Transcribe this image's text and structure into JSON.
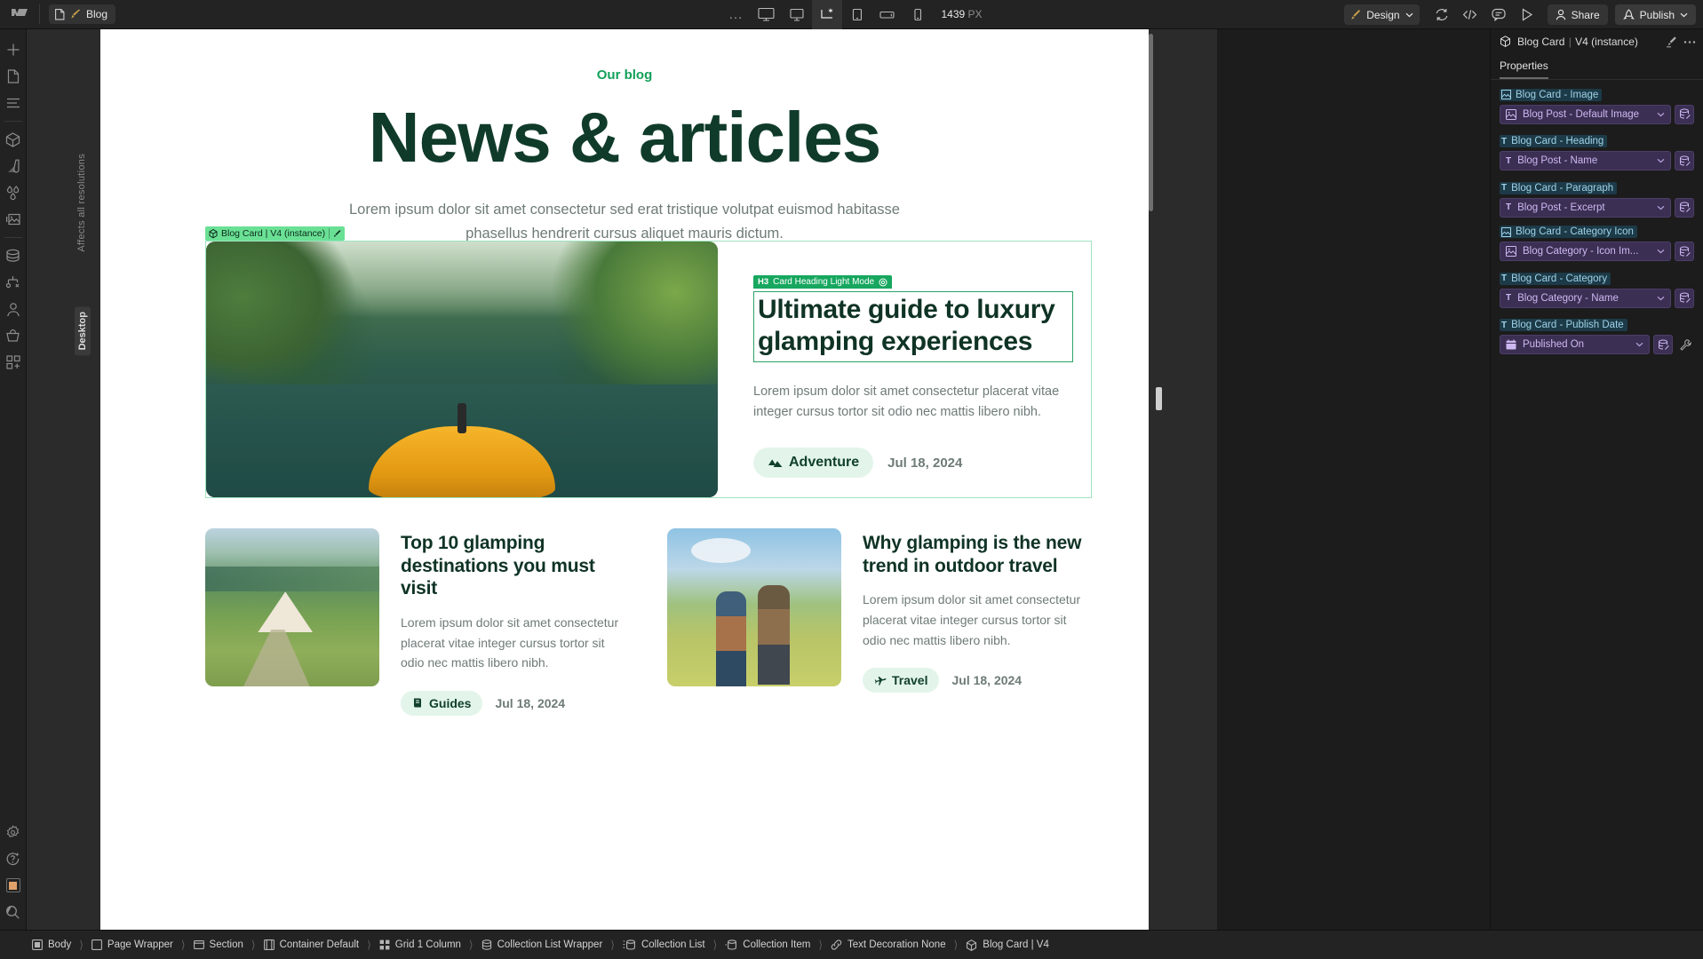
{
  "topbar": {
    "logo": "webflow-logo",
    "page_tab": {
      "label": "Blog",
      "page_icon": "page-icon",
      "brush_icon": "brush-icon"
    },
    "more_dots": "...",
    "breakpoints": [
      {
        "name": "desktop-large",
        "icon": "monitor-large-icon",
        "active": false
      },
      {
        "name": "desktop",
        "icon": "monitor-icon",
        "active": false
      },
      {
        "name": "laptop-base",
        "icon": "laptop-base-icon",
        "active": true
      },
      {
        "name": "tablet",
        "icon": "tablet-icon",
        "active": false
      },
      {
        "name": "mobile-landscape",
        "icon": "mobile-landscape-icon",
        "active": false
      },
      {
        "name": "mobile-portrait",
        "icon": "mobile-portrait-icon",
        "active": false
      }
    ],
    "viewport_value": "1439",
    "viewport_unit": "PX",
    "design_mode": "Design",
    "actions": [
      {
        "name": "sync-icon"
      },
      {
        "name": "code-icon"
      },
      {
        "name": "comment-icon"
      },
      {
        "name": "preview-icon"
      }
    ],
    "share_label": "Share",
    "publish_label": "Publish"
  },
  "left_rail": {
    "items": [
      {
        "name": "add-element",
        "icon": "plus-icon"
      },
      {
        "name": "pages",
        "icon": "page-icon"
      },
      {
        "name": "navigator",
        "icon": "layers-icon"
      },
      {
        "name": "components",
        "icon": "cube-icon"
      },
      {
        "name": "style-selectors",
        "icon": "paint-swatch-icon"
      },
      {
        "name": "variables",
        "icon": "droplets-icon"
      },
      {
        "name": "assets",
        "icon": "image-icon"
      },
      {
        "name": "cms",
        "icon": "database-icon"
      },
      {
        "name": "logic",
        "icon": "logic-icon"
      },
      {
        "name": "users",
        "icon": "user-icon"
      },
      {
        "name": "ecommerce",
        "icon": "basket-icon"
      },
      {
        "name": "apps",
        "icon": "apps-grid-icon"
      }
    ],
    "bottom_items": [
      {
        "name": "settings",
        "icon": "gear-icon"
      },
      {
        "name": "ai-help",
        "icon": "help-sparkle-icon"
      },
      {
        "name": "color-swatch",
        "icon": "orange-square-icon"
      },
      {
        "name": "search",
        "icon": "magnifier-icon"
      },
      {
        "name": "video",
        "icon": "video-camera-icon"
      }
    ]
  },
  "canvas": {
    "ruler_note": "Affects all resolutions",
    "breakpoint_chip": "Desktop",
    "component_badge": {
      "label": "Blog Card | V4 (instance)",
      "cube_icon": "cube-icon",
      "edit_icon": "pencil-icon"
    },
    "page": {
      "eyebrow": "Our blog",
      "title": "News & articles",
      "subtitle": "Lorem ipsum dolor sit amet consectetur sed erat tristique volutpat euismod habitasse phasellus hendrerit cursus aliquet mauris dictum."
    },
    "hero_card": {
      "image_alt": "kayak-on-forest-lake-image",
      "heading_badge": {
        "tag": "H3",
        "label": "Card Heading Light Mode",
        "state_icon": "target-icon"
      },
      "heading": "Ultimate guide to luxury glamping experiences",
      "paragraph": "Lorem ipsum dolor sit amet consectetur placerat vitae integer cursus tortor sit odio nec mattis libero nibh.",
      "category": "Adventure",
      "category_icon": "mountain-icon",
      "date": "Jul 18, 2024"
    },
    "cards": [
      {
        "image_alt": "glamping-tent-in-valley-image",
        "heading": "Top 10 glamping destinations you must visit",
        "paragraph": "Lorem ipsum dolor sit amet consectetur placerat vitae integer cursus tortor sit odio nec mattis libero nibh.",
        "category": "Guides",
        "category_icon": "book-icon",
        "date": "Jul 18, 2024"
      },
      {
        "image_alt": "couple-with-backpacks-image",
        "heading": "Why glamping is the new trend in outdoor travel",
        "paragraph": "Lorem ipsum dolor sit amet consectetur placerat vitae integer cursus tortor sit odio nec mattis libero nibh.",
        "category": "Travel",
        "category_icon": "airplane-icon",
        "date": "Jul 18, 2024"
      }
    ]
  },
  "right_panel": {
    "header": {
      "component": "Blog Card",
      "variant": "V4 (instance)",
      "cube_icon": "cube-icon",
      "edit_icon": "edit-component-icon",
      "more_icon": "more-dots-icon"
    },
    "tab": "Properties",
    "properties": [
      {
        "label": "Blog Card - Image",
        "label_icon": "image-icon",
        "value": "Blog Post - Default Image",
        "value_icon": "image-icon",
        "has_db": true,
        "has_wrench": false
      },
      {
        "label": "Blog Card - Heading",
        "label_icon": "text-icon",
        "value": "Blog Post - Name",
        "value_icon": "text-icon",
        "has_db": true,
        "has_wrench": false
      },
      {
        "label": "Blog Card - Paragraph",
        "label_icon": "text-icon",
        "value": "Blog Post - Excerpt",
        "value_icon": "text-icon",
        "has_db": true,
        "has_wrench": false
      },
      {
        "label": "Blog Card - Category Icon",
        "label_icon": "image-icon",
        "value": "Blog Category - Icon Im...",
        "value_icon": "image-icon",
        "has_db": true,
        "has_wrench": false
      },
      {
        "label": "Blog Card - Category",
        "label_icon": "text-icon",
        "value": "Blog Category - Name",
        "value_icon": "text-icon",
        "has_db": true,
        "has_wrench": false
      },
      {
        "label": "Blog Card - Publish Date",
        "label_icon": "text-icon",
        "value": "Published On",
        "value_icon": "calendar-icon",
        "has_db": true,
        "has_wrench": true
      }
    ]
  },
  "breadcrumbs": [
    {
      "label": "Body",
      "icon": "body-icon"
    },
    {
      "label": "Page Wrapper",
      "icon": "div-icon"
    },
    {
      "label": "Section",
      "icon": "section-icon"
    },
    {
      "label": "Container Default",
      "icon": "container-icon"
    },
    {
      "label": "Grid 1 Column",
      "icon": "grid-icon"
    },
    {
      "label": "Collection List Wrapper",
      "icon": "collection-icon"
    },
    {
      "label": "Collection List",
      "icon": "collection-list-icon"
    },
    {
      "label": "Collection Item",
      "icon": "collection-item-icon"
    },
    {
      "label": "Text Decoration None",
      "icon": "link-icon"
    },
    {
      "label": "Blog Card | V4",
      "icon": "cube-icon"
    }
  ],
  "colors": {
    "accent_green": "#12a05a",
    "heading_green": "#103b2b",
    "badge_green": "#6ae095",
    "panel_purple": "#3b2f53",
    "label_blue": "#9fd2e8"
  }
}
